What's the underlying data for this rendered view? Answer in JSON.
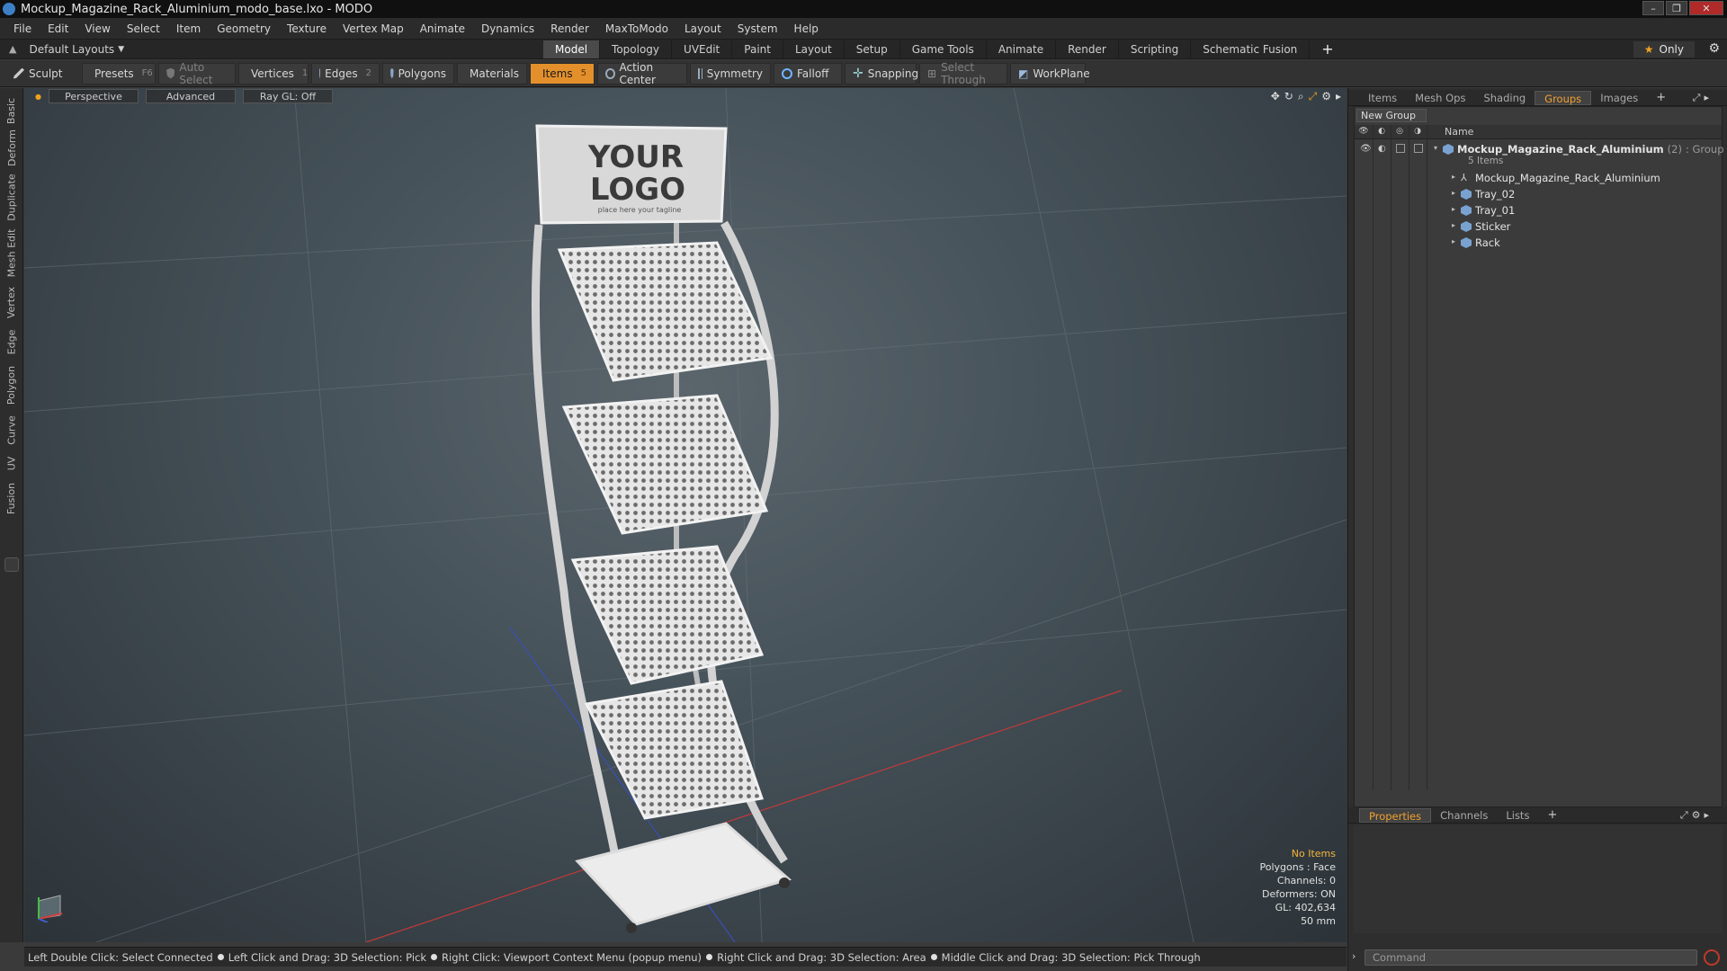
{
  "window": {
    "title": "Mockup_Magazine_Rack_Aluminium_modo_base.lxo - MODO"
  },
  "menu": [
    "File",
    "Edit",
    "View",
    "Select",
    "Item",
    "Geometry",
    "Texture",
    "Vertex Map",
    "Animate",
    "Dynamics",
    "Render",
    "MaxToModo",
    "Layout",
    "System",
    "Help"
  ],
  "layout": {
    "selector": "Default Layouts",
    "tabs": [
      "Model",
      "Topology",
      "UVEdit",
      "Paint",
      "Layout",
      "Setup",
      "Game Tools",
      "Animate",
      "Render",
      "Scripting",
      "Schematic Fusion"
    ],
    "active_tab": "Model",
    "only_label": "Only"
  },
  "toolbar": {
    "sculpt": "Sculpt",
    "presets": "Presets",
    "presets_key": "F6",
    "auto_select": "Auto Select",
    "vertices": "Vertices",
    "vertices_count": "1",
    "edges": "Edges",
    "edges_count": "2",
    "polygons": "Polygons",
    "materials": "Materials",
    "items": "Items",
    "items_count": "5",
    "action_center": "Action Center",
    "symmetry": "Symmetry",
    "falloff": "Falloff",
    "snapping": "Snapping",
    "select_through": "Select Through",
    "workplane": "WorkPlane"
  },
  "left_tabs": [
    "Basic",
    "Deform",
    "Duplicate",
    "Mesh Edit",
    "Vertex",
    "Edge",
    "Polygon",
    "Curve",
    "UV",
    "Fusion"
  ],
  "viewport": {
    "view": "Perspective",
    "shading": "Advanced",
    "raygl": "Ray GL: Off",
    "logo_line1": "YOUR",
    "logo_line2": "LOGO",
    "logo_tagline": "place here your tagline",
    "stats": {
      "selection": "No Items",
      "polygons": "Polygons : Face",
      "channels": "Channels: 0",
      "deformers": "Deformers: ON",
      "gl": "GL: 402,634",
      "scale": "50 mm"
    }
  },
  "status_hints": [
    "Left Double Click: Select Connected",
    "Left Click and Drag: 3D Selection: Pick",
    "Right Click: Viewport Context Menu (popup menu)",
    "Right Click and Drag: 3D Selection: Area",
    "Middle Click and Drag: 3D Selection: Pick Through"
  ],
  "panel_top": {
    "tabs": [
      "Items",
      "Mesh Ops",
      "Shading",
      "Groups",
      "Images"
    ],
    "active_tab": "Groups",
    "new_group": "New Group",
    "column_name": "Name",
    "group": {
      "name": "Mockup_Magazine_Rack_Aluminium",
      "count": "(2)",
      "kind": ": Group",
      "sub": "5 Items"
    },
    "children": [
      "Mockup_Magazine_Rack_Aluminium",
      "Tray_02",
      "Tray_01",
      "Sticker",
      "Rack"
    ]
  },
  "panel_bottom": {
    "tabs": [
      "Properties",
      "Channels",
      "Lists"
    ],
    "active_tab": "Properties",
    "command_placeholder": "Command"
  },
  "colors": {
    "accent": "#e3902c",
    "active_tab_text": "#f2a030",
    "viewport_bg": "#46525a"
  }
}
